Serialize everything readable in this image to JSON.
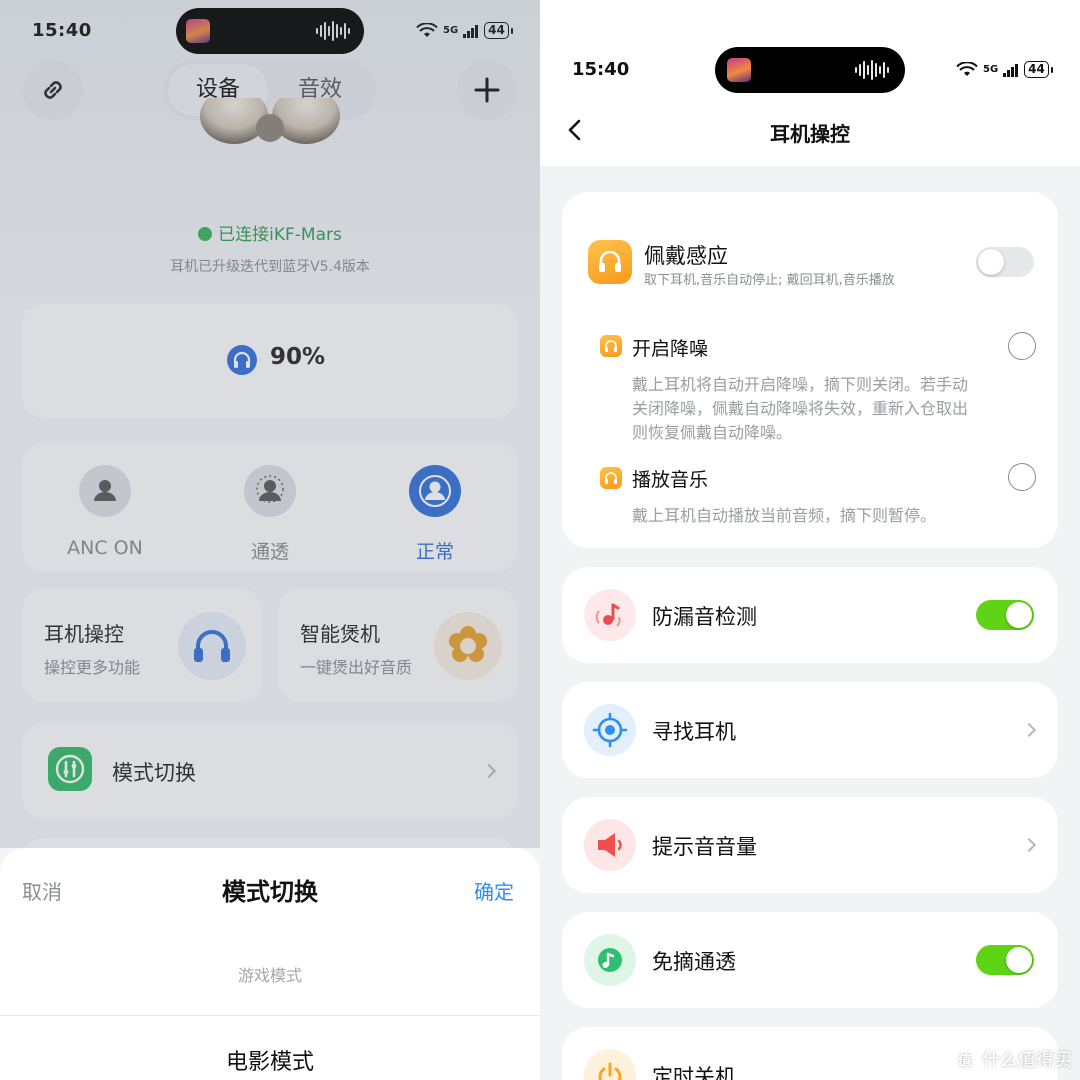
{
  "left": {
    "status": {
      "time": "15:40",
      "battery": "44",
      "network": "5G"
    },
    "top_tabs": [
      "设备",
      "音效"
    ],
    "connection": {
      "text": "已连接iKF-Mars",
      "sub": "耳机已升级迭代到蓝牙V5.4版本"
    },
    "battery_level": "90%",
    "modes": [
      {
        "label": "ANC ON",
        "active": false
      },
      {
        "label": "通透",
        "active": false
      },
      {
        "label": "正常",
        "active": true
      }
    ],
    "features": [
      {
        "title": "耳机操控",
        "sub": "操控更多功能",
        "icon": "headphones-icon"
      },
      {
        "title": "智能煲机",
        "sub": "一键煲出好音质",
        "icon": "flower-icon"
      }
    ],
    "mode_switch_row": {
      "label": "模式切换",
      "icon": "equalizer-icon"
    },
    "sheet": {
      "cancel": "取消",
      "title": "模式切换",
      "confirm": "确定",
      "options": [
        "游戏模式",
        "电影模式"
      ]
    }
  },
  "right": {
    "status": {
      "time": "15:40",
      "battery": "44",
      "network": "5G"
    },
    "nav_title": "耳机操控",
    "wear": {
      "title": "佩戴感应",
      "sub": "取下耳机,音乐自动停止; 戴回耳机,音乐播放",
      "enabled": false,
      "options": [
        {
          "title": "开启降噪",
          "desc": [
            "戴上耳机将自动开启降噪，摘下则关闭。若手动",
            "关闭降噪，佩戴自动降噪将失效，重新入仓取出",
            "则恢复佩戴自动降噪。"
          ]
        },
        {
          "title": "播放音乐",
          "desc": [
            "戴上耳机自动播放当前音频，摘下则暂停。"
          ]
        }
      ]
    },
    "rows": [
      {
        "label": "防漏音检测",
        "control": "toggle",
        "enabled": true,
        "icon": "leak-sound-icon",
        "color": "#f06060"
      },
      {
        "label": "寻找耳机",
        "control": "chevron",
        "icon": "locate-icon",
        "color": "#2f8ff0"
      },
      {
        "label": "提示音音量",
        "control": "chevron",
        "icon": "speaker-icon",
        "color": "#f05a5a"
      },
      {
        "label": "免摘通透",
        "control": "toggle",
        "enabled": true,
        "icon": "transparency-icon",
        "color": "#2fbf71"
      },
      {
        "label": "定时关机",
        "control": "chevron",
        "icon": "power-icon",
        "color": "#f7a623"
      }
    ],
    "watermark": {
      "logo": "值",
      "text": "什么值得买"
    }
  },
  "colors": {
    "accent_blue": "#2f6fd8",
    "toggle_green": "#5fd416",
    "connected_green": "#34b15b",
    "confirm_blue": "#2f8ff0"
  }
}
